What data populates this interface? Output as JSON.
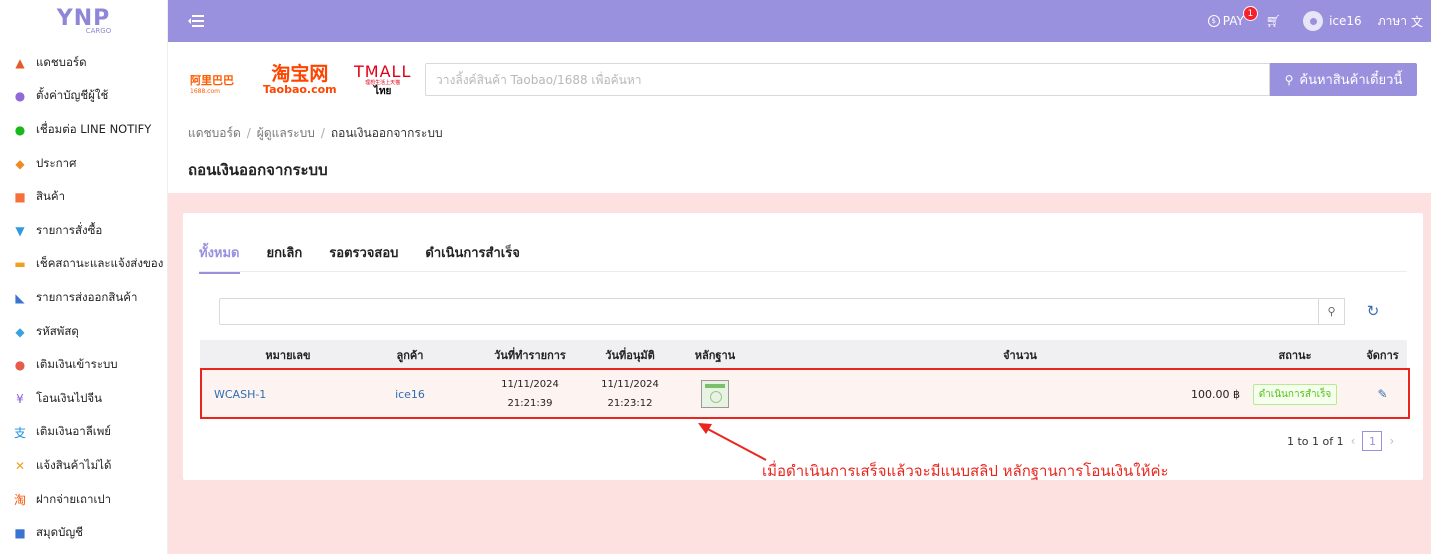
{
  "logo": {
    "main": "YNP",
    "sub": "CARGO"
  },
  "sidebar": {
    "items": [
      {
        "label": "แดชบอร์ด",
        "icon": "chart-icon",
        "glyph": "▲",
        "color": "#e8592a"
      },
      {
        "label": "ตั้งค่าบัญชีผู้ใช้",
        "icon": "user-settings-icon",
        "glyph": "●",
        "color": "#8f6ad8"
      },
      {
        "label": "เชื่อมต่อ LINE NOTIFY",
        "icon": "line-icon",
        "glyph": "●",
        "color": "#1bb81b"
      },
      {
        "label": "ประกาศ",
        "icon": "megaphone-icon",
        "glyph": "◆",
        "color": "#f08a24"
      },
      {
        "label": "สินค้า",
        "icon": "shopping-bag-icon",
        "glyph": "■",
        "color": "#f5703a"
      },
      {
        "label": "รายการสั่งซื้อ",
        "icon": "basket-icon",
        "glyph": "▼",
        "color": "#2e9be0"
      },
      {
        "label": "เช็คสถานะและแจ้งส่งของ",
        "icon": "truck-icon",
        "glyph": "▬",
        "color": "#f0a020"
      },
      {
        "label": "รายการส่งออกสินค้า",
        "icon": "cart-export-icon",
        "glyph": "◣",
        "color": "#3a74d0"
      },
      {
        "label": "รหัสพัสดุ",
        "icon": "box-icon",
        "glyph": "◆",
        "color": "#3aa0e0"
      },
      {
        "label": "เติมเงินเข้าระบบ",
        "icon": "piggy-bank-icon",
        "glyph": "●",
        "color": "#e85a4a"
      },
      {
        "label": "โอนเงินไปจีน",
        "icon": "yuan-icon",
        "glyph": "¥",
        "color": "#8f5ad8"
      },
      {
        "label": "เติมเงินอาลีเพย์",
        "icon": "alipay-icon",
        "glyph": "支",
        "color": "#1a8fe0"
      },
      {
        "label": "แจ้งสินค้าไม่ได้",
        "icon": "report-icon",
        "glyph": "✕",
        "color": "#f0a020"
      },
      {
        "label": "ฝากจ่ายเถาเปา",
        "icon": "taobao-icon",
        "glyph": "淘",
        "color": "#ff5000"
      },
      {
        "label": "สมุดบัญชี",
        "icon": "wallet-icon",
        "glyph": "■",
        "color": "#3a74d0"
      }
    ]
  },
  "header": {
    "pay_label": "PAY",
    "pay_badge": "1",
    "username": "ice16",
    "lang_label": "ภาษา"
  },
  "search": {
    "brands": {
      "b1688_main": "阿里巴巴",
      "b1688_sub": "1688.com",
      "taobao_main": "淘宝网",
      "taobao_sub": "Taobao.com",
      "tmall_main": "TMALL",
      "tmall_sub": "理想生活上天猫",
      "tmall_th": "ไทย"
    },
    "placeholder": "วางลิ้งค์สินค้า Taobao/1688 เพื่อค้นหา",
    "button_label": "ค้นหาสินค้าเดี๋ยวนี้"
  },
  "breadcrumb": {
    "items": [
      "แดชบอร์ด",
      "ผู้ดูแลระบบ",
      "ถอนเงินออกจากระบบ"
    ]
  },
  "page": {
    "title": "ถอนเงินออกจากระบบ"
  },
  "tabs": [
    "ทั้งหมด",
    "ยกเลิก",
    "รอตรวจสอบ",
    "ดำเนินการสำเร็จ"
  ],
  "table": {
    "headers": {
      "id": "หมายเลข",
      "customer": "ลูกค้า",
      "created": "วันที่ทำรายการ",
      "approved": "วันที่อนุมัติ",
      "proof": "หลักฐาน",
      "amount": "จำนวน",
      "status": "สถานะ",
      "actions": "จัดการ"
    },
    "rows": [
      {
        "id": "WCASH-1",
        "customer": "ice16",
        "created_date": "11/11/2024",
        "created_time": "21:21:39",
        "approved_date": "11/11/2024",
        "approved_time": "21:23:12",
        "amount": "100.00 ฿",
        "status": "ดำเนินการสำเร็จ"
      }
    ]
  },
  "pagination": {
    "summary": "1 to 1 of 1",
    "current": "1"
  },
  "annotation": {
    "text": "เมื่อดำเนินการเสร็จแล้วจะมีแนบสลิป  หลักฐานการโอนเงินให้ค่ะ"
  },
  "colors": {
    "accent": "#9990de",
    "highlight": "#e8261e",
    "success": "#52c41a",
    "background_pink": "#fde0e0"
  }
}
